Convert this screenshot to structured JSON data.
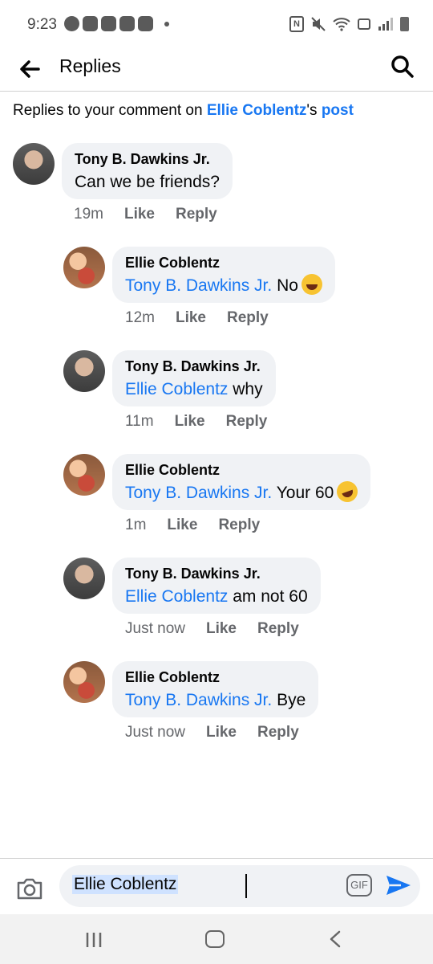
{
  "status_bar": {
    "time": "9:23",
    "nfc_label": "N"
  },
  "header": {
    "title": "Replies",
    "back_icon": "arrow-left-icon",
    "search_icon": "search-icon"
  },
  "context": {
    "prefix": "Replies to your comment on ",
    "name": "Ellie Coblentz",
    "suffix": "'s ",
    "post_label": "post"
  },
  "comments": [
    {
      "author": "Tony B. Dawkins Jr.",
      "mention": "",
      "text": "Can we be friends?",
      "emoji": "",
      "time": "19m",
      "like": "Like",
      "reply": "Reply"
    },
    {
      "author": "Ellie Coblentz",
      "mention": "Tony B. Dawkins Jr.",
      "text": " No",
      "emoji": "face-with-tears-of-joy",
      "time": "12m",
      "like": "Like",
      "reply": "Reply"
    },
    {
      "author": "Tony B. Dawkins Jr.",
      "mention": "Ellie Coblentz",
      "text": " why",
      "emoji": "",
      "time": "11m",
      "like": "Like",
      "reply": "Reply"
    },
    {
      "author": "Ellie Coblentz",
      "mention": "Tony B. Dawkins Jr.",
      "text": " Your 60",
      "emoji": "rolling-on-the-floor-laughing",
      "time": "1m",
      "like": "Like",
      "reply": "Reply"
    },
    {
      "author": "Tony B. Dawkins Jr.",
      "mention": "Ellie Coblentz",
      "text": " am not 60",
      "emoji": "",
      "time": "Just now",
      "like": "Like",
      "reply": "Reply"
    },
    {
      "author": "Ellie Coblentz",
      "mention": "Tony B. Dawkins Jr.",
      "text": " Bye",
      "emoji": "",
      "time": "Just now",
      "like": "Like",
      "reply": "Reply"
    }
  ],
  "composer": {
    "input_value": "Ellie Coblentz",
    "gif_label": "GIF",
    "camera_icon": "camera-icon",
    "send_icon": "send-icon"
  },
  "colors": {
    "link": "#1877f2",
    "bubble": "#f0f2f5",
    "meta": "#65676b"
  }
}
